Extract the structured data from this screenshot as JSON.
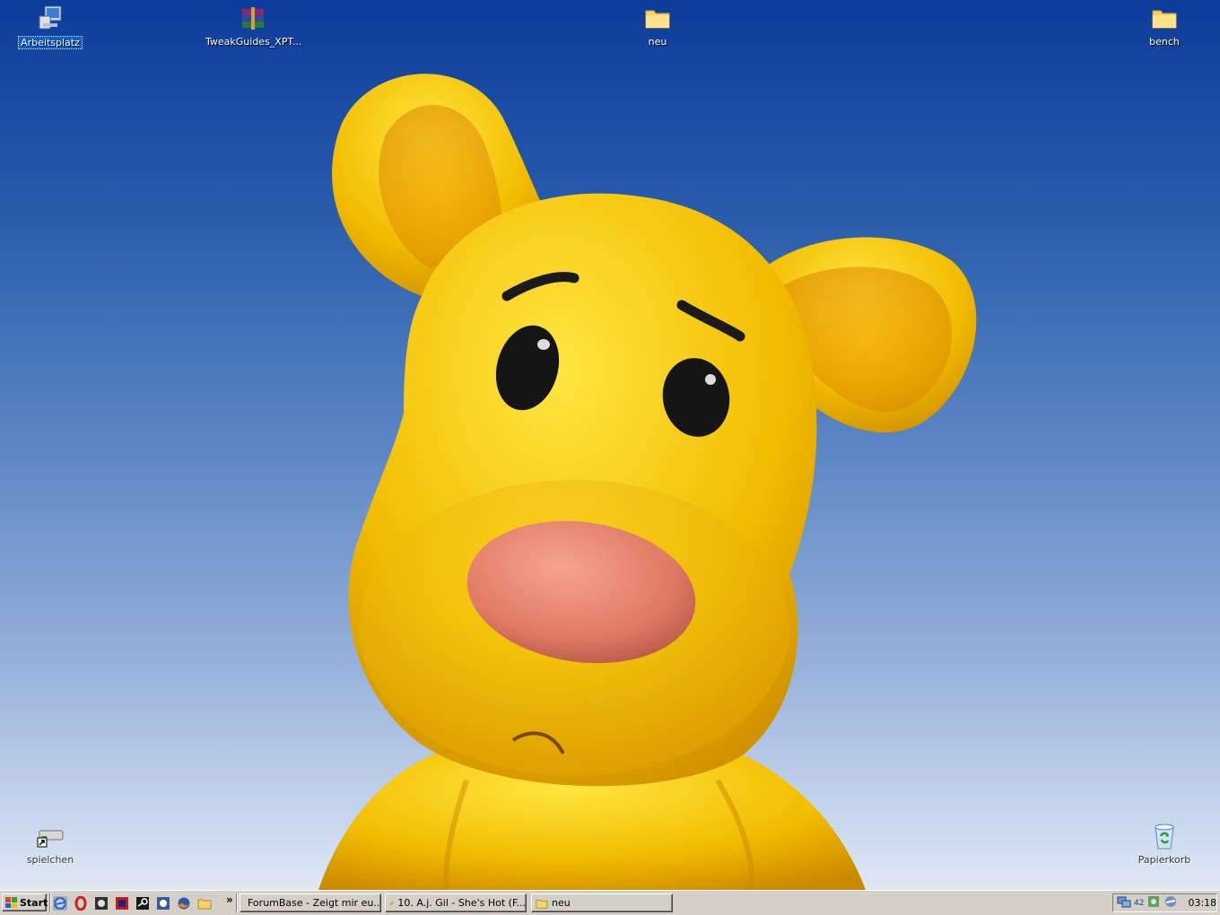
{
  "desktop": {
    "icons": [
      {
        "name": "Arbeitsplatz",
        "icon": "my-computer-icon"
      },
      {
        "name": "TweakGuides_XPT...",
        "icon": "winrar-archive-icon"
      },
      {
        "name": "neu",
        "icon": "folder-icon"
      },
      {
        "name": "bench",
        "icon": "folder-icon"
      },
      {
        "name": "spielchen",
        "icon": "drive-shortcut-icon"
      },
      {
        "name": "Papierkorb",
        "icon": "recycle-bin-icon"
      }
    ]
  },
  "taskbar": {
    "start_label": "Start",
    "quick_launch": [
      "internet-explorer-icon",
      "opera-icon",
      "app-icon",
      "game-icon",
      "steam-icon",
      "help-icon",
      "firefox-icon",
      "folder-icon"
    ],
    "more_label": "»",
    "tasks": [
      {
        "label": "ForumBase - Zeigt mir eu...",
        "icon": "opera-icon"
      },
      {
        "label": "10. A.j. Gil - She's Hot (F...",
        "icon": "media-player-icon"
      },
      {
        "label": "neu",
        "icon": "folder-icon"
      }
    ],
    "tray": {
      "icons": [
        "network-icon",
        "counter-icon",
        "driver-icon",
        "volume-icon"
      ],
      "counter": "42",
      "clock": "03:18"
    }
  },
  "colors": {
    "desktop_top": "#0c3c9c",
    "desktop_bottom": "#dfe8f5",
    "taskbar": "#d4d0c8",
    "bear": "#f5c800",
    "nose": "#e88a70"
  }
}
